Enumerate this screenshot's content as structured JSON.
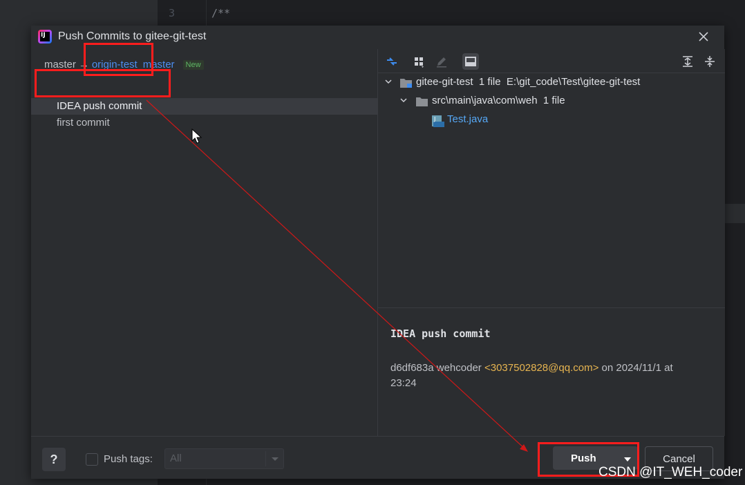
{
  "background": {
    "line_number": "3",
    "code": "/**"
  },
  "dialog": {
    "title": "Push Commits to gitee-git-test",
    "close_icon": "close-icon",
    "app_icon_letter": "IJ"
  },
  "branches": {
    "local": "master",
    "arrow": "→",
    "remote": "origin-test",
    "remote_branch": "master",
    "badge": "New"
  },
  "commits": [
    {
      "message": "IDEA push commit",
      "selected": true
    },
    {
      "message": "first commit",
      "selected": false
    }
  ],
  "toolbar": {
    "buttons": [
      "compare-icon",
      "group-by-icon",
      "edit-icon",
      "preview-icon",
      "expand-all-icon",
      "collapse-all-icon"
    ]
  },
  "tree": {
    "root_name": "gitee-git-test",
    "root_count": "1 file",
    "root_path": "E:\\git_code\\Test\\gitee-git-test",
    "dir_name": "src\\main\\java\\com\\weh",
    "dir_count": "1 file",
    "file_name": "Test.java"
  },
  "details": {
    "title": "IDEA push commit",
    "hash": "d6df683a",
    "author": "wehcoder",
    "email": "<3037502828@qq.com>",
    "on": "on",
    "date": "2024/11/1 at",
    "time": "23:24"
  },
  "bottom": {
    "help": "?",
    "push_tags_label": "Push tags:",
    "push_tags_value": "All",
    "push_label": "Push",
    "cancel_label": "Cancel"
  },
  "watermark": "CSDN @IT_WEH_coder",
  "colors": {
    "accent_link": "#4d8ef0",
    "email": "#e6b450",
    "annotation": "#ff1d1d",
    "new_badge": "#5fb865"
  }
}
